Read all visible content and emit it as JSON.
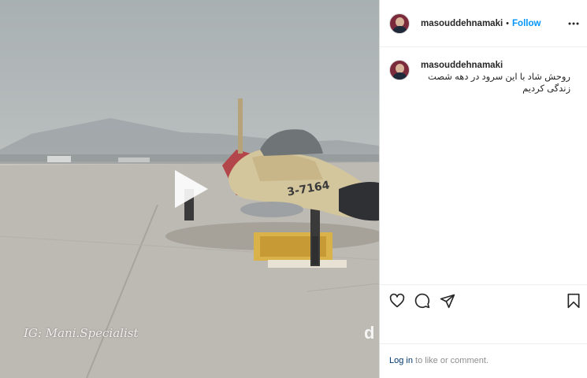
{
  "media": {
    "watermark": "IG: Mani.Specialist",
    "corner_mark": "d",
    "tail_number": "3-7164"
  },
  "post": {
    "username": "masouddehnamaki",
    "dot": "•",
    "follow_label": "Follow",
    "caption_username": "masouddehnamaki",
    "caption_text": "روحش شاد با این سرود در دهه شصت زندگی کردیم"
  },
  "footer": {
    "login_label": "Log in",
    "rest": " to like or comment."
  },
  "colors": {
    "link_blue": "#0095f6",
    "dark_link": "#00376b",
    "muted": "#8e8e8e"
  },
  "icons": [
    "play-icon",
    "more-options-icon",
    "heart-icon",
    "comment-icon",
    "share-icon",
    "bookmark-icon"
  ]
}
